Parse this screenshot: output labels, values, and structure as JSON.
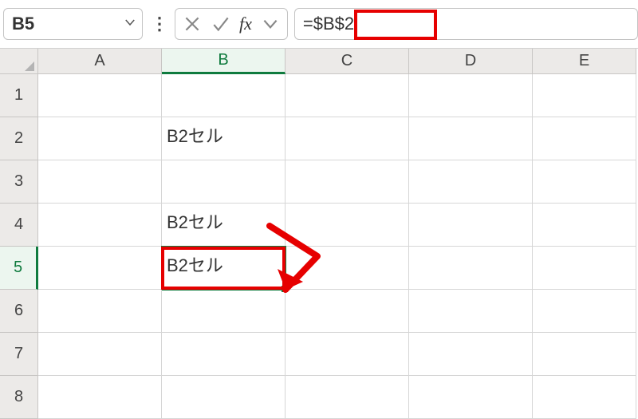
{
  "nameBox": {
    "value": "B5"
  },
  "formulaBar": {
    "content": "=$B$2"
  },
  "columns": [
    "A",
    "B",
    "C",
    "D",
    "E"
  ],
  "rows": [
    {
      "num": "1",
      "cells": {
        "A": "",
        "B": "",
        "C": "",
        "D": "",
        "E": ""
      }
    },
    {
      "num": "2",
      "cells": {
        "A": "",
        "B": "B2セル",
        "C": "",
        "D": "",
        "E": ""
      }
    },
    {
      "num": "3",
      "cells": {
        "A": "",
        "B": "",
        "C": "",
        "D": "",
        "E": ""
      }
    },
    {
      "num": "4",
      "cells": {
        "A": "",
        "B": "B2セル",
        "C": "",
        "D": "",
        "E": ""
      }
    },
    {
      "num": "5",
      "cells": {
        "A": "",
        "B": "B2セル",
        "C": "",
        "D": "",
        "E": ""
      }
    },
    {
      "num": "6",
      "cells": {
        "A": "",
        "B": "",
        "C": "",
        "D": "",
        "E": ""
      }
    },
    {
      "num": "7",
      "cells": {
        "A": "",
        "B": "",
        "C": "",
        "D": "",
        "E": ""
      }
    },
    {
      "num": "8",
      "cells": {
        "A": "",
        "B": "",
        "C": "",
        "D": "",
        "E": ""
      }
    }
  ],
  "selected": {
    "row": 5,
    "col": "B"
  }
}
